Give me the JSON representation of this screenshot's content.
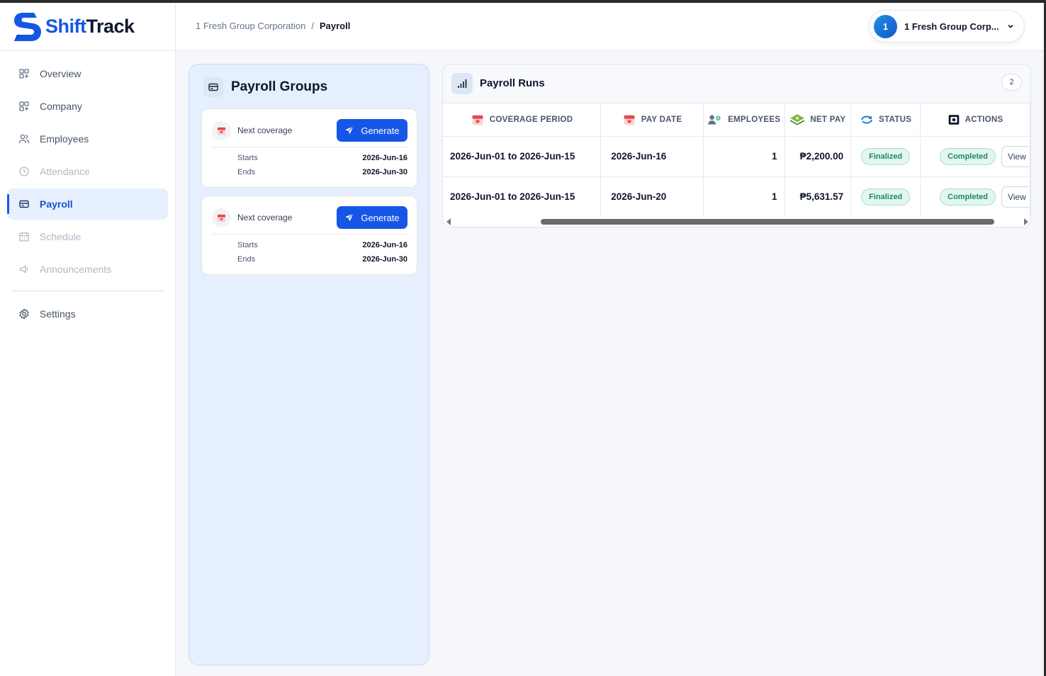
{
  "brand": {
    "part1": "Shift",
    "part2": "Track"
  },
  "sidebar": {
    "items": [
      {
        "label": "Overview",
        "icon": "grid-icon",
        "state": "normal"
      },
      {
        "label": "Company",
        "icon": "grid-icon",
        "state": "normal"
      },
      {
        "label": "Employees",
        "icon": "users-icon",
        "state": "normal"
      },
      {
        "label": "Attendance",
        "icon": "clock-icon",
        "state": "disabled"
      },
      {
        "label": "Payroll",
        "icon": "payroll-card-icon",
        "state": "active"
      },
      {
        "label": "Schedule",
        "icon": "calendar-icon",
        "state": "disabled"
      },
      {
        "label": "Announcements",
        "icon": "megaphone-icon",
        "state": "disabled"
      }
    ],
    "settings_label": "Settings"
  },
  "header": {
    "breadcrumb": {
      "parent": "1 Fresh Group Corporation",
      "separator": "/",
      "current": "Payroll"
    },
    "company_switcher": {
      "avatar": "1",
      "name": "1 Fresh Group Corp..."
    }
  },
  "payroll_groups": {
    "title": "Payroll Groups",
    "cards": [
      {
        "label": "Next coverage",
        "button": "Generate",
        "starts_label": "Starts",
        "starts": "2026-Jun-16",
        "ends_label": "Ends",
        "ends": "2026-Jun-30"
      },
      {
        "label": "Next coverage",
        "button": "Generate",
        "starts_label": "Starts",
        "starts": "2026-Jun-16",
        "ends_label": "Ends",
        "ends": "2026-Jun-30"
      }
    ]
  },
  "payroll_runs": {
    "title": "Payroll Runs",
    "count": "2",
    "columns": [
      "COVERAGE PERIOD",
      "PAY DATE",
      "EMPLOYEES",
      "NET PAY",
      "STATUS",
      "ACTIONS"
    ],
    "rows": [
      {
        "coverage": "2026-Jun-01 to 2026-Jun-15",
        "pay_date": "2026-Jun-16",
        "employees": "1",
        "net_pay": "₱2,200.00",
        "status": "Finalized",
        "action_status": "Completed",
        "view": "View"
      },
      {
        "coverage": "2026-Jun-01 to 2026-Jun-15",
        "pay_date": "2026-Jun-20",
        "employees": "1",
        "net_pay": "₱5,631.57",
        "status": "Finalized",
        "action_status": "Completed",
        "view": "View"
      }
    ]
  },
  "colors": {
    "accent": "#1656e6",
    "status_green": "#1c8a5f",
    "panel_blue": "#e6effd"
  }
}
